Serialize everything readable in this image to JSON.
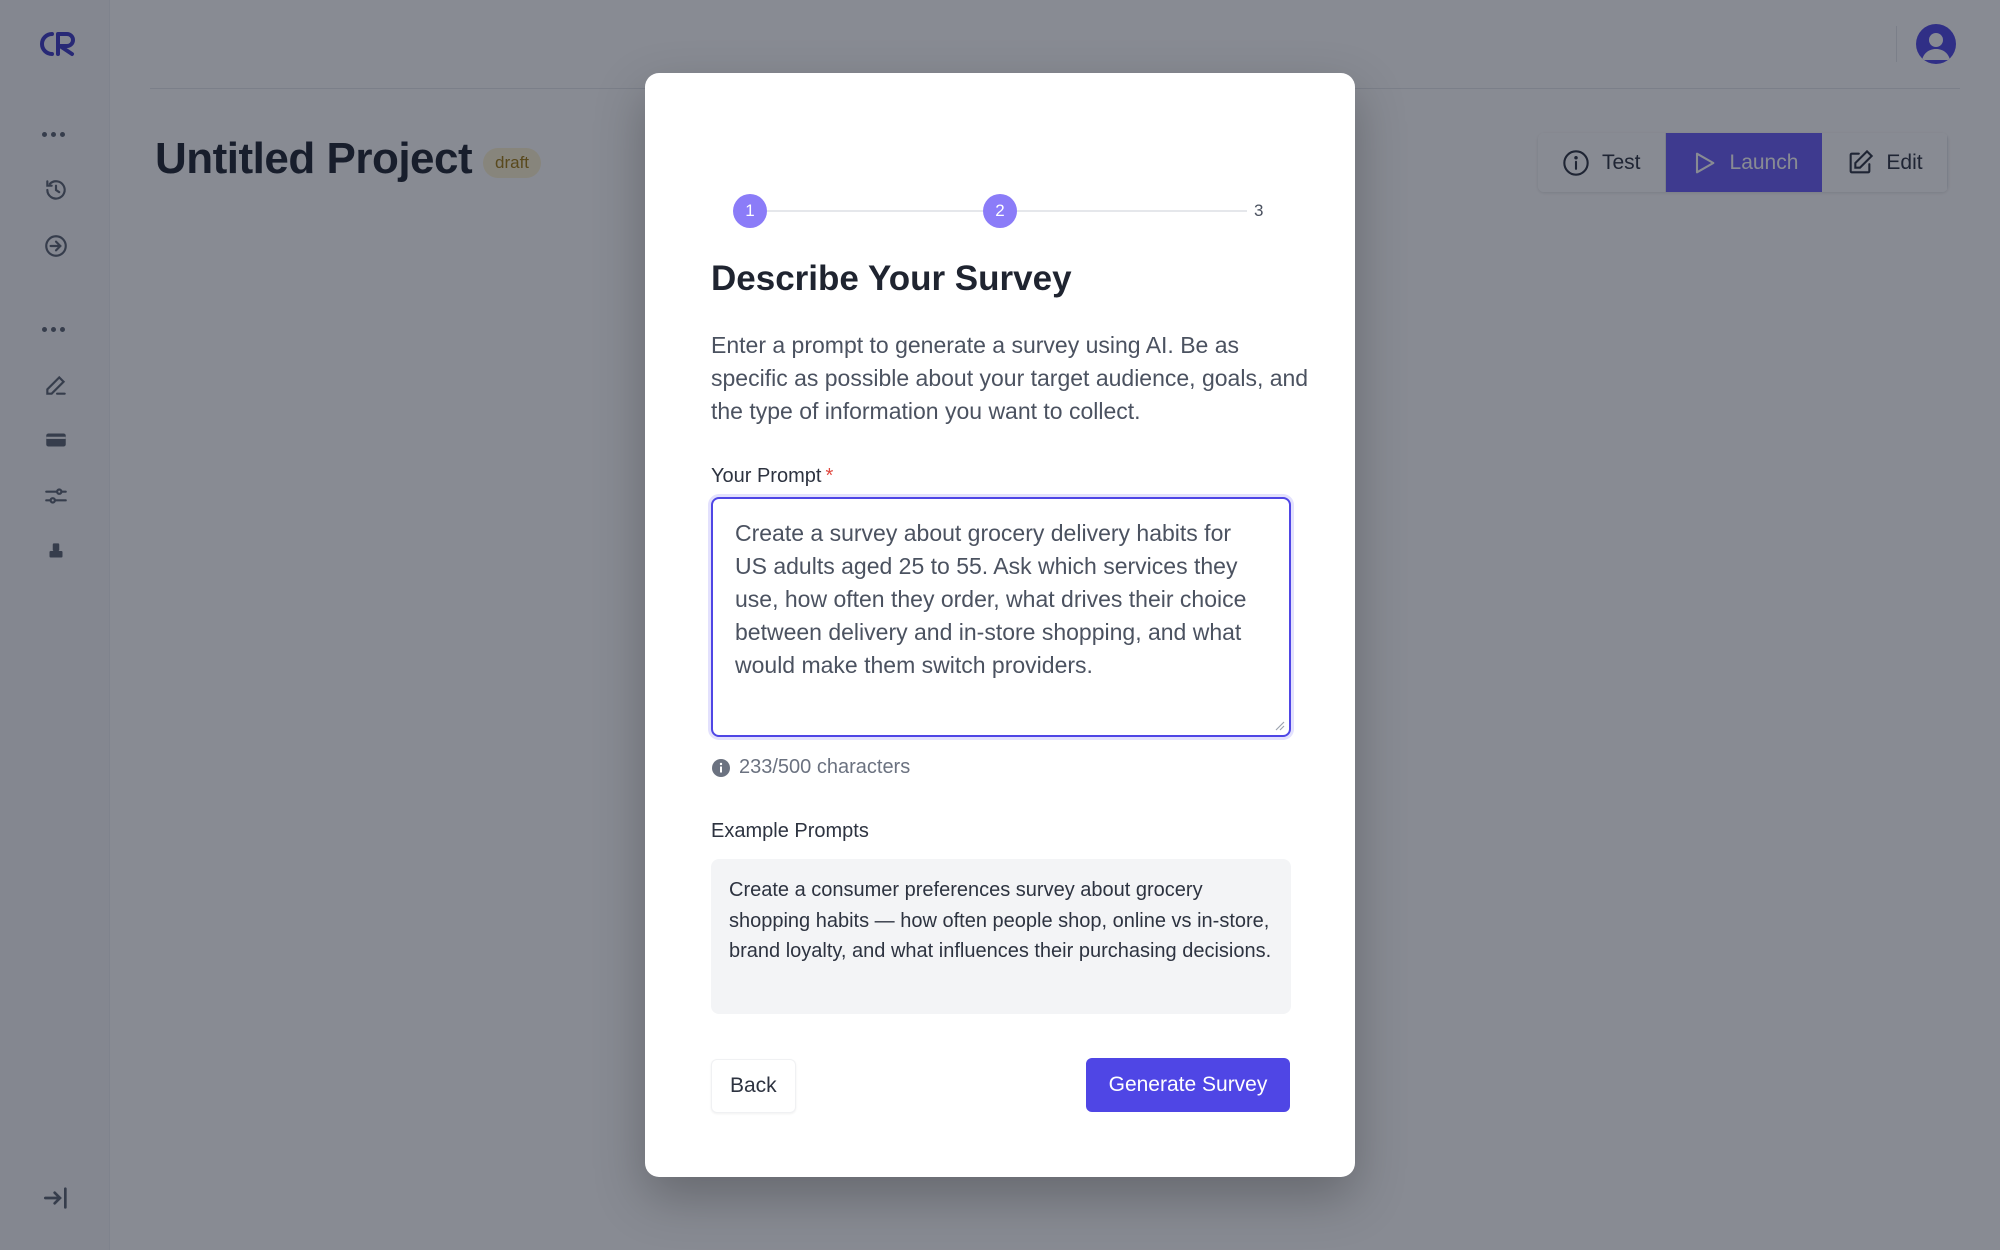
{
  "app": {
    "logo_text": "CR",
    "accent": "#4f46e5",
    "launch_color": "#6b5cf6"
  },
  "sidebar": {
    "icons": [
      "more-icon",
      "clock-icon",
      "enter-icon",
      "more-icon",
      "pencil-icon",
      "card-icon",
      "sliders-icon",
      "stamp-icon",
      "collapse-icon"
    ]
  },
  "project": {
    "title": "Untitled Project",
    "status": "draft"
  },
  "toolbar": {
    "test_label": "Test",
    "launch_label": "Launch",
    "edit_label": "Edit"
  },
  "modal": {
    "steps": [
      "1",
      "2",
      "3"
    ],
    "current_step": 2,
    "title": "Describe Your Survey",
    "description": "Enter a prompt to generate a survey using AI. Be as specific as possible about your target audience, goals, and the type of information you want to collect.",
    "prompt_label": "Your Prompt",
    "required_marker": "*",
    "prompt_value": "Create a survey about grocery delivery habits for US adults aged 25 to 55. Ask which services they use, how often they order, what drives their choice between delivery and in-store shopping, and what would make them switch providers.",
    "char_count": "233/500 characters",
    "examples_label": "Example Prompts",
    "example_text": "Create a consumer preferences survey about grocery shopping habits — how often people shop, online vs in-store, brand loyalty, and what influences their purchasing decisions.",
    "back_label": "Back",
    "generate_label": "Generate Survey"
  }
}
